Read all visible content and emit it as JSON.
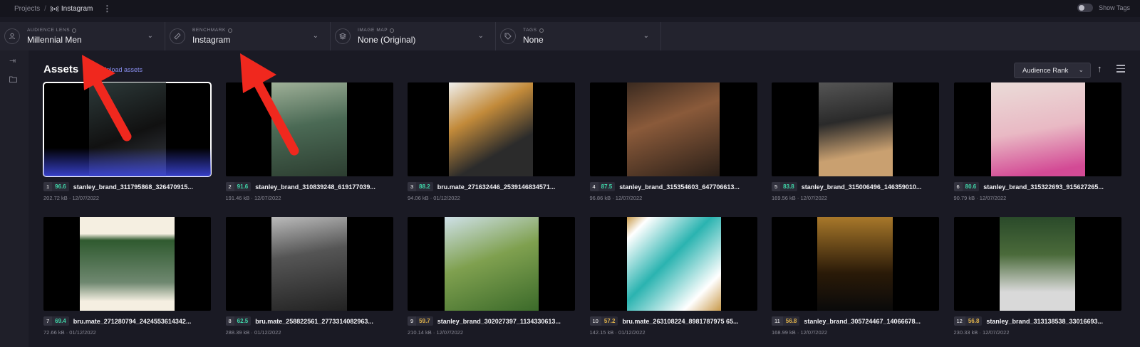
{
  "breadcrumb": {
    "root": "Projects",
    "current": "Instagram"
  },
  "toggle": {
    "label": "Show Tags"
  },
  "filters": [
    {
      "label": "AUDIENCE LENS",
      "value": "Millennial Men",
      "icon": "user-icon"
    },
    {
      "label": "BENCHMARK",
      "value": "Instagram",
      "icon": "ruler-icon"
    },
    {
      "label": "IMAGE MAP",
      "value": "None (Original)",
      "icon": "layers-icon"
    },
    {
      "label": "TAGS",
      "value": "None",
      "icon": "tag-icon"
    }
  ],
  "assets": {
    "title": "Assets",
    "upload": "Upload assets"
  },
  "sort": {
    "label": "Audience Rank"
  },
  "colors": {
    "accent": "#8a8ff0",
    "score_green": "#3fd6a8",
    "score_amber": "#e0b24a",
    "selection": "#3c46dc"
  },
  "cards": [
    {
      "rank": "1",
      "score": "96.6",
      "name": "stanley_brand_311795868_326470915...",
      "size": "202.72 kB",
      "date": "12/07/2022",
      "tone": "green"
    },
    {
      "rank": "2",
      "score": "91.6",
      "name": "stanley_brand_310839248_619177039...",
      "size": "191.46 kB",
      "date": "12/07/2022",
      "tone": "green"
    },
    {
      "rank": "3",
      "score": "88.2",
      "name": "bru.mate_271632446_2539146834571...",
      "size": "94.06 kB",
      "date": "01/12/2022",
      "tone": "green"
    },
    {
      "rank": "4",
      "score": "87.5",
      "name": "stanley_brand_315354603_647706613...",
      "size": "96.86 kB",
      "date": "12/07/2022",
      "tone": "green"
    },
    {
      "rank": "5",
      "score": "83.8",
      "name": "stanley_brand_315006496_146359010...",
      "size": "169.56 kB",
      "date": "12/07/2022",
      "tone": "green"
    },
    {
      "rank": "6",
      "score": "80.6",
      "name": "stanley_brand_315322693_915627265...",
      "size": "90.79 kB",
      "date": "12/07/2022",
      "tone": "green"
    },
    {
      "rank": "7",
      "score": "69.4",
      "name": "bru.mate_271280794_2424553614342...",
      "size": "72.66 kB",
      "date": "01/12/2022",
      "tone": "green"
    },
    {
      "rank": "8",
      "score": "62.5",
      "name": "bru.mate_258822561_2773314082963...",
      "size": "288.39 kB",
      "date": "01/12/2022",
      "tone": "green"
    },
    {
      "rank": "9",
      "score": "59.7",
      "name": "stanley_brand_302027397_1134330613...",
      "size": "210.14 kB",
      "date": "12/07/2022",
      "tone": "amber"
    },
    {
      "rank": "10",
      "score": "57.2",
      "name": "bru.mate_263108224_8981787975 65...",
      "size": "142.15 kB",
      "date": "01/12/2022",
      "tone": "amber"
    },
    {
      "rank": "11",
      "score": "56.8",
      "name": "stanley_brand_305724467_14066678...",
      "size": "168.99 kB",
      "date": "12/07/2022",
      "tone": "amber"
    },
    {
      "rank": "12",
      "score": "56.8",
      "name": "stanley_brand_313138538_33016693...",
      "size": "230.33 kB",
      "date": "12/07/2022",
      "tone": "amber"
    }
  ]
}
